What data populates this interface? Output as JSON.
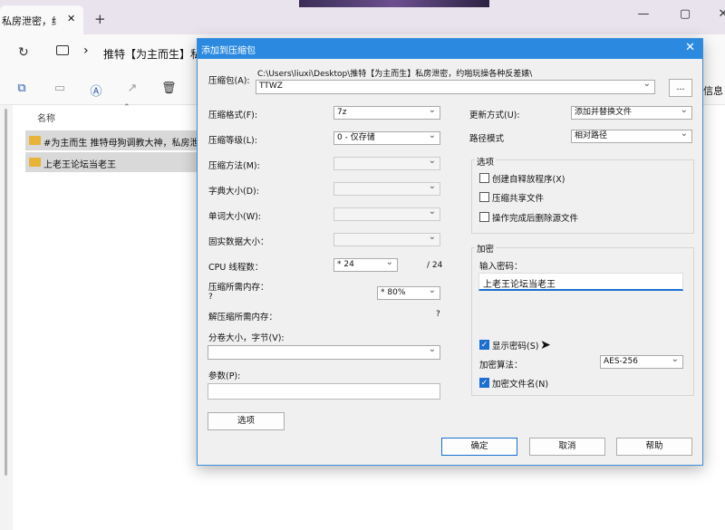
{
  "browser": {
    "tab_title": "私房泄密，约",
    "new_tab": "+",
    "breadcrumb": "推特【为主而生】私",
    "sep": "›"
  },
  "explorer": {
    "column_name": "名称",
    "info": "信息",
    "items": [
      "#为主而生 推特母狗调教大神，私房泄",
      "上老王论坛当老王"
    ]
  },
  "dialog": {
    "title": "添加到压缩包",
    "archive_label": "压缩包(A):",
    "archive_path": "C:\\Users\\liuxi\\Desktop\\推特【为主而生】私房泄密，约啪玩操各种反差婊\\",
    "archive_name": "TTWZ",
    "browse": "...",
    "left": [
      {
        "label": "压缩格式(F):",
        "value": "7z"
      },
      {
        "label": "压缩等级(L):",
        "value": "0 - 仅存储"
      },
      {
        "label": "压缩方法(M):",
        "value": ""
      },
      {
        "label": "字典大小(D):",
        "value": ""
      },
      {
        "label": "单词大小(W):",
        "value": ""
      },
      {
        "label": "固实数据大小：",
        "value": ""
      }
    ],
    "cpu_label": "CPU 线程数：",
    "cpu_value": "* 24",
    "cpu_total": "/ 24",
    "mem_label": "压缩所需内存：",
    "mem_q": "?",
    "mem_value": "* 80%",
    "dmem_label": "解压缩所需内存：",
    "dmem_q": "?",
    "split_label": "分卷大小，字节(V):",
    "params_label": "参数(P):",
    "options_btn": "选项",
    "update_label": "更新方式(U):",
    "update_value": "添加并替换文件",
    "path_label": "路径模式",
    "path_value": "相对路径",
    "opt_group": "选项",
    "opts": [
      "创建自释放程序(X)",
      "压缩共享文件",
      "操作完成后删除源文件"
    ],
    "enc_group": "加密",
    "pwd_label": "输入密码：",
    "pwd_value": "上老王论坛当老王",
    "show_pwd": "显示密码(S)",
    "alg_label": "加密算法：",
    "alg_value": "AES-256",
    "enc_names": "加密文件名(N)",
    "ok": "确定",
    "cancel": "取消",
    "help": "帮助"
  }
}
